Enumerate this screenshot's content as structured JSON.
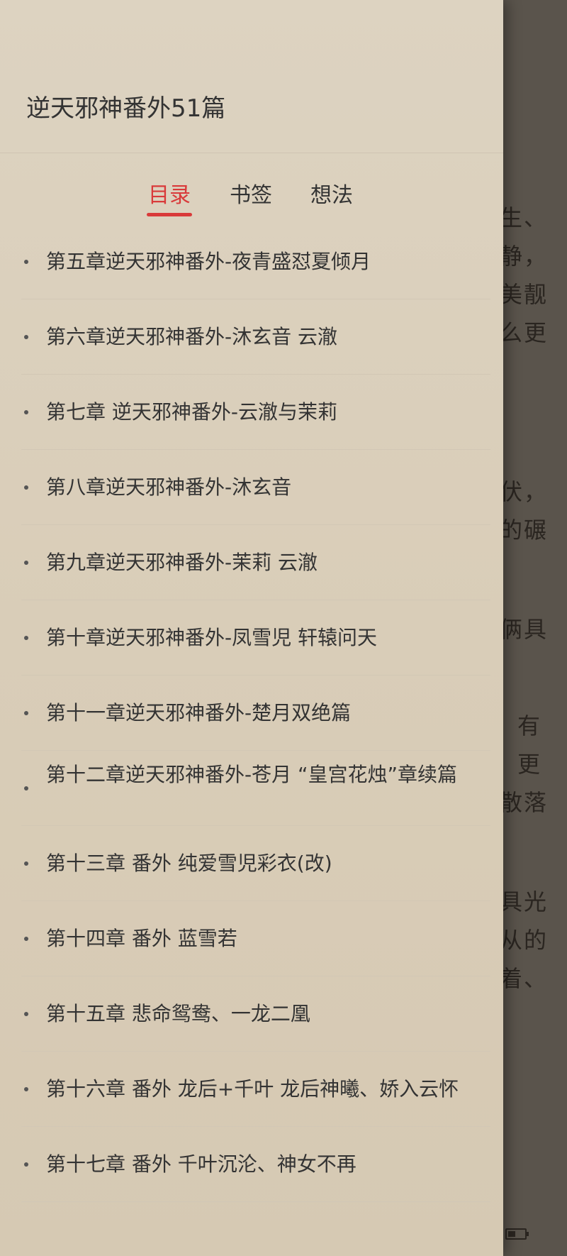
{
  "reader_background": {
    "lines": [
      "生、",
      "静，",
      "美靓",
      "么更",
      "伏，",
      "的碾",
      "俩具",
      "有",
      "更",
      "散落",
      "具光",
      "从的",
      "着、"
    ]
  },
  "drawer": {
    "book_title": "逆天邪神番外51篇",
    "tabs": [
      {
        "label": "目录",
        "active": true
      },
      {
        "label": "书签",
        "active": false
      },
      {
        "label": "想法",
        "active": false
      }
    ],
    "chapters": [
      "第五章逆天邪神番外-夜青盛怼夏倾月",
      "第六章逆天邪神番外-沐玄音 云澈",
      "第七章 逆天邪神番外-云澈与茉莉",
      "第八章逆天邪神番外-沐玄音",
      "第九章逆天邪神番外-茉莉 云澈",
      "第十章逆天邪神番外-凤雪児 轩辕问天",
      "第十一章逆天邪神番外-楚月双绝篇",
      "第十二章逆天邪神番外-苍月 “皇宫花烛”章续篇",
      "第十三章 番外 纯爱雪児彩衣(改)",
      "第十四章 番外 蓝雪若",
      "第十五章 悲命鸳鸯、一龙二凰",
      "第十六章 番外 龙后+千叶 龙后神曦、娇入云怀",
      "第十七章 番外 千叶沉沦、神女不再"
    ]
  }
}
